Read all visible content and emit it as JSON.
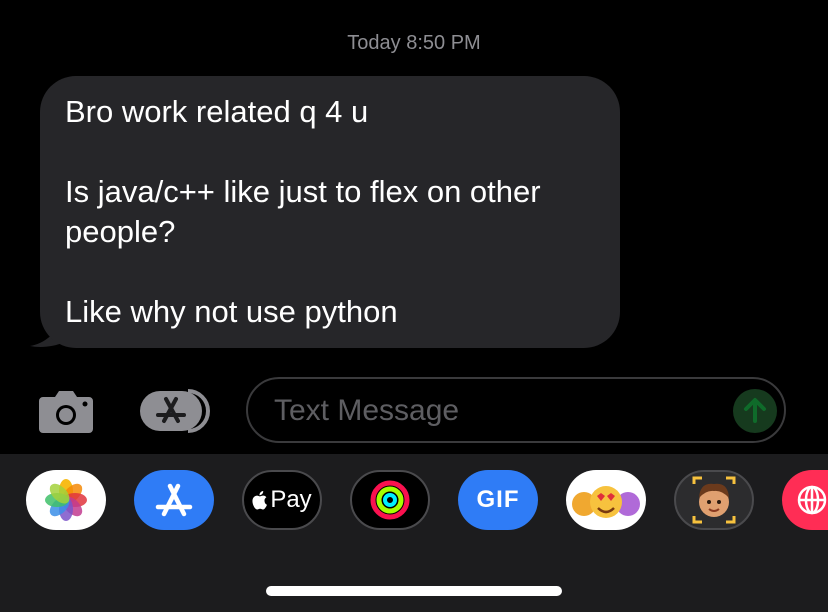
{
  "conversation": {
    "timestamp": "Today 8:50 PM",
    "message": {
      "line1": "Bro work related q 4 u",
      "line2": "Is java/c++ like just to flex on other",
      "line3": "people?",
      "line4": "Like why not use python"
    }
  },
  "compose": {
    "placeholder": "Text Message",
    "camera_icon": "camera-icon",
    "apps_icon": "app-store-icon",
    "send_icon": "send-arrow-icon"
  },
  "app_drawer": {
    "apps": [
      {
        "name": "Photos",
        "icon": "photos-icon"
      },
      {
        "name": "App Store",
        "icon": "app-store-icon"
      },
      {
        "name": "Apple Pay",
        "label": "Pay",
        "icon": "apple-pay-icon"
      },
      {
        "name": "Fitness",
        "icon": "activity-rings-icon"
      },
      {
        "name": "GIF",
        "label": "GIF",
        "icon": "gif-icon"
      },
      {
        "name": "Animoji",
        "icon": "animoji-icon"
      },
      {
        "name": "Memoji",
        "icon": "memoji-icon"
      },
      {
        "name": "Web",
        "icon": "globe-icon"
      }
    ]
  },
  "colors": {
    "bubble": "#262629",
    "drawer": "#1c1c1e",
    "accent_blue": "#2f7cf6",
    "send_green": "#163a1e"
  }
}
